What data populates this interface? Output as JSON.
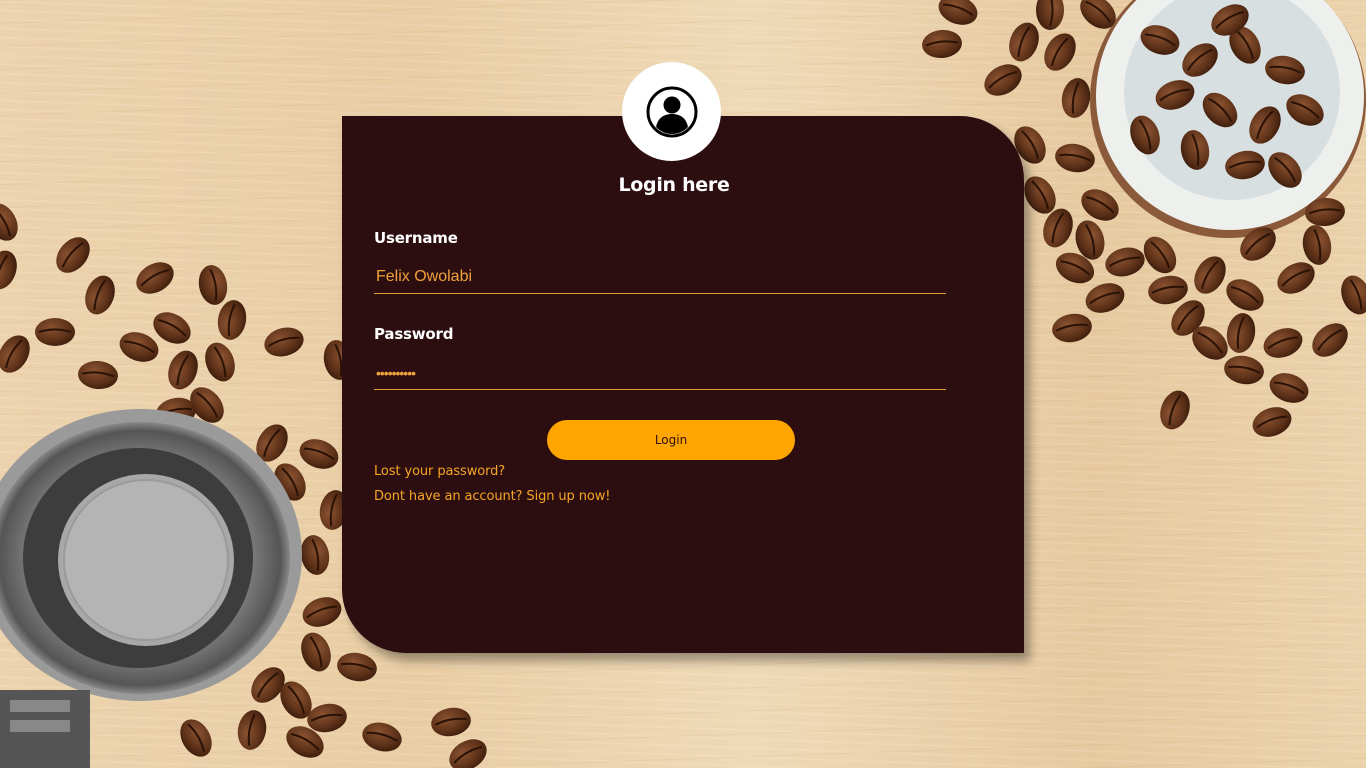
{
  "form": {
    "title": "Login here",
    "username_label": "Username",
    "username_value": "Felix Owolabi",
    "password_label": "Password",
    "password_value": "••••••••••",
    "login_button_label": "Login",
    "lost_password_link": "Lost your password?",
    "signup_link": "Dont have an account? Sign up now!"
  },
  "icons": {
    "avatar": "user-circle-icon"
  },
  "colors": {
    "card_background": "#2c0e10",
    "accent": "#ffa500",
    "link": "#f5a623",
    "input_text": "#f0a13c"
  }
}
